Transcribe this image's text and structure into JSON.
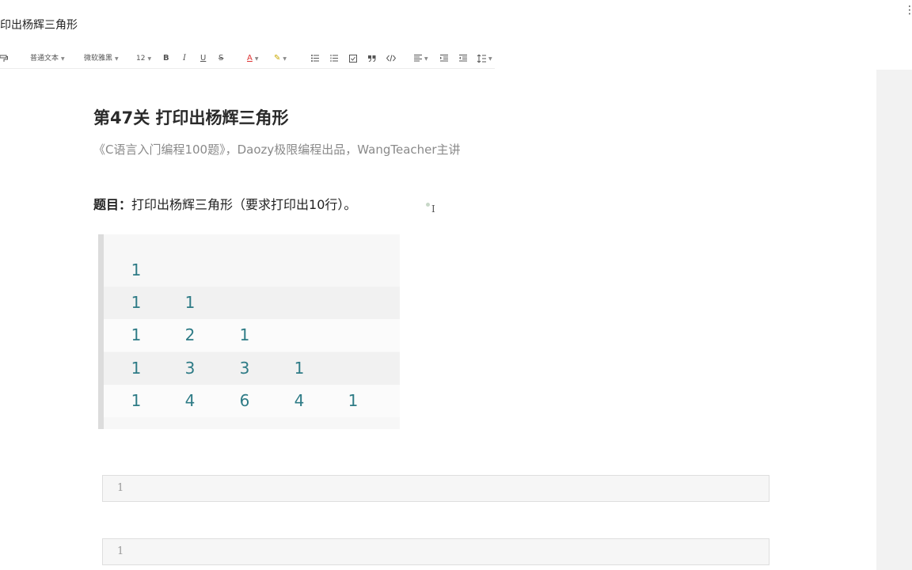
{
  "window": {
    "title": "印出杨辉三角形",
    "more_icon": "⋮"
  },
  "toolbar": {
    "format_painter_icon": "paint-format-icon",
    "paragraph_style": "普通文本",
    "font_family": "微软雅黑",
    "font_size": "12",
    "bold": "B",
    "italic": "I",
    "underline": "U",
    "strike": "S",
    "text_color": "A",
    "highlight": "✎",
    "text_color_hex": "#d33333"
  },
  "document": {
    "heading": "第47关 打印出杨辉三角形",
    "subtitle": "《C语言入门编程100题》，Daozy极限编程出品，WangTeacher主讲",
    "question_label": "题目：",
    "question_text": "打印出杨辉三角形（要求打印出10行）。",
    "triangle_rows": [
      [
        "1"
      ],
      [
        "1",
        "1"
      ],
      [
        "1",
        "2",
        "1"
      ],
      [
        "1",
        "3",
        "3",
        "1"
      ],
      [
        "1",
        "4",
        "6",
        "4",
        "1"
      ]
    ],
    "triangle_color": "#2e7b86",
    "code_blocks": [
      {
        "line_number": "1"
      },
      {
        "line_number": "1"
      }
    ]
  }
}
